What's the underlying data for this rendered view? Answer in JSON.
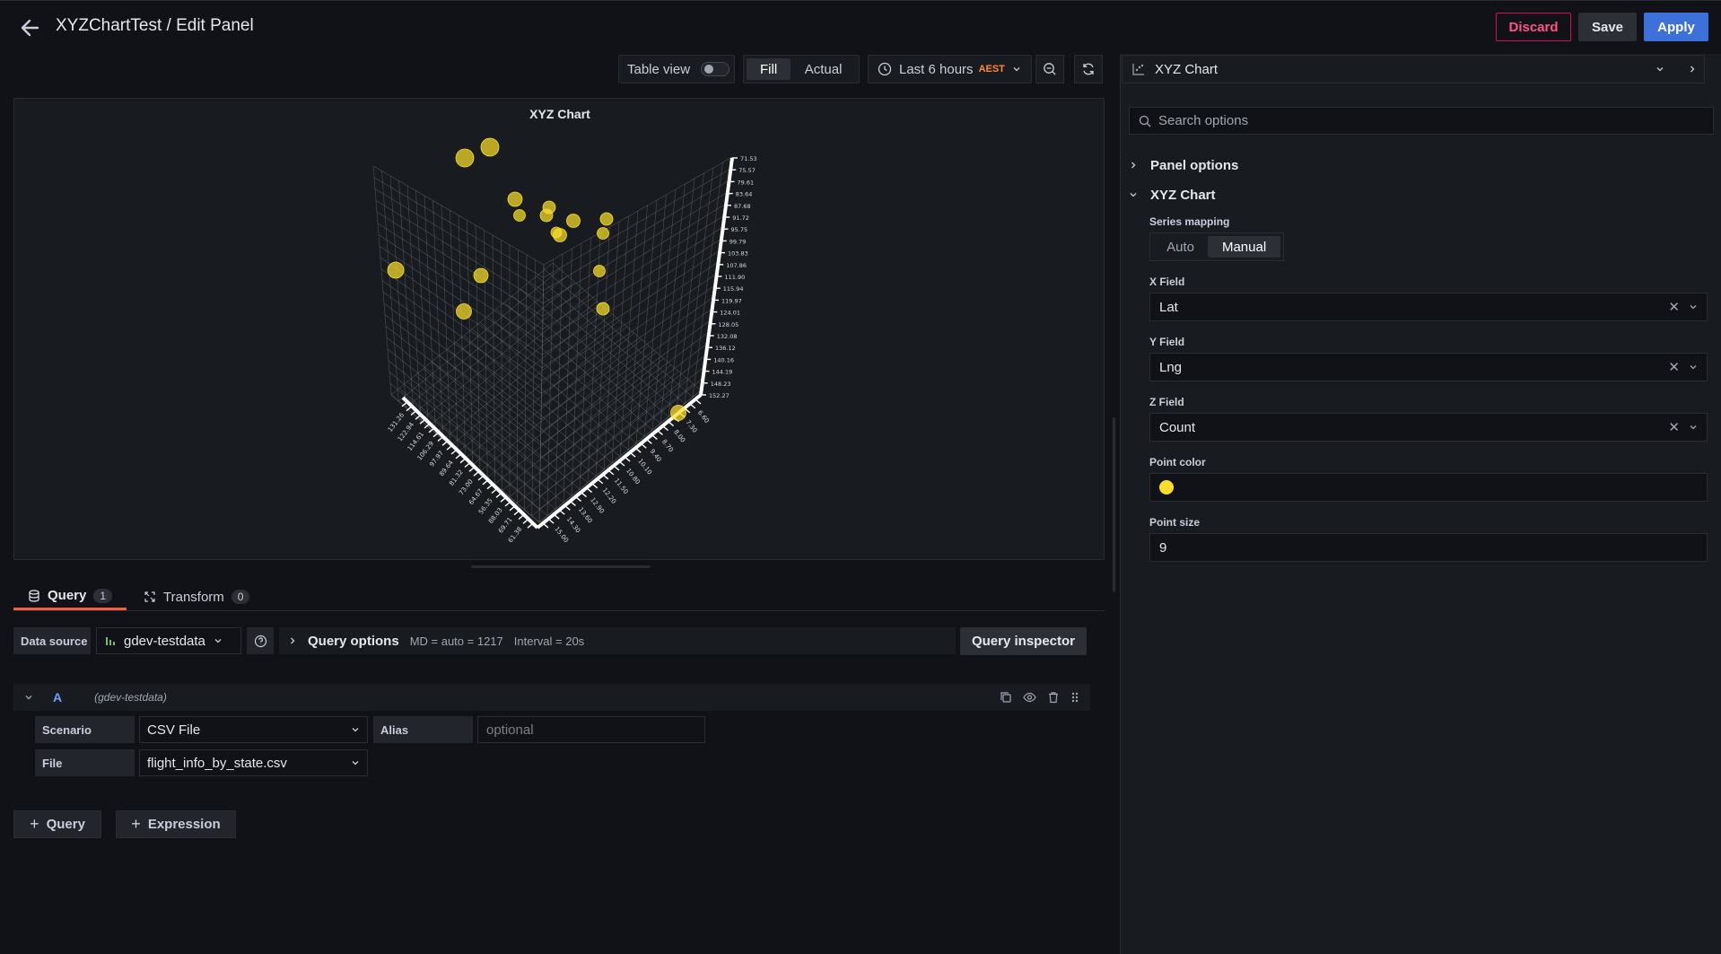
{
  "header": {
    "title": "XYZChartTest / Edit Panel",
    "discard_label": "Discard",
    "save_label": "Save",
    "apply_label": "Apply"
  },
  "toolbar": {
    "table_view_label": "Table view",
    "table_view_on": false,
    "fill_label": "Fill",
    "actual_label": "Actual",
    "time_range": "Last 6 hours",
    "timezone": "AEST"
  },
  "panel": {
    "title": "XYZ Chart",
    "point_color": "#fade2a"
  },
  "chart_data": {
    "type": "scatter",
    "title": "XYZ Chart",
    "z_ticks": [
      "71.53",
      "75.57",
      "79.61",
      "83.64",
      "87.68",
      "91.72",
      "95.75",
      "99.79",
      "103.83",
      "107.86",
      "111.90",
      "115.94",
      "119.97",
      "124.01",
      "128.05",
      "132.08",
      "136.12",
      "140.16",
      "144.19",
      "148.23",
      "152.27"
    ],
    "x_ticks": [
      "61.38",
      "69.71",
      "88.03",
      "56.35",
      "64.67",
      "73.00",
      "81.32",
      "89.64",
      "97.97",
      "106.29",
      "114.61",
      "122.94",
      "131.26"
    ],
    "y_ticks": [
      "15.00",
      "14.30",
      "13.60",
      "12.90",
      "12.20",
      "11.50",
      "10.80",
      "10.10",
      "9.40",
      "8.70",
      "8.00",
      "7.30",
      "6.60"
    ]
  },
  "query_tabs": [
    {
      "label": "Query",
      "count": "1"
    },
    {
      "label": "Transform",
      "count": "0"
    }
  ],
  "datasource": {
    "label": "Data source",
    "value": "gdev-testdata",
    "query_options_label": "Query options",
    "md": "MD = auto = 1217",
    "interval": "Interval = 20s",
    "inspector_label": "Query inspector"
  },
  "query_a": {
    "ref_id": "A",
    "datasource": "(gdev-testdata)",
    "scenario_label": "Scenario",
    "scenario_value": "CSV File",
    "alias_label": "Alias",
    "alias_placeholder": "optional",
    "file_label": "File",
    "file_value": "flight_info_by_state.csv"
  },
  "add_buttons": {
    "query_label": "Query",
    "expression_label": "Expression"
  },
  "options": {
    "viz_name": "XYZ Chart",
    "search_placeholder": "Search options",
    "panel_options_label": "Panel options",
    "xyz_group_label": "XYZ Chart",
    "series_mapping_label": "Series mapping",
    "mapping_auto": "Auto",
    "mapping_manual": "Manual",
    "x_field_label": "X Field",
    "x_field_value": "Lat",
    "y_field_label": "Y Field",
    "y_field_value": "Lng",
    "z_field_label": "Z Field",
    "z_field_value": "Count",
    "point_color_label": "Point color",
    "point_size_label": "Point size",
    "point_size_value": "9"
  }
}
